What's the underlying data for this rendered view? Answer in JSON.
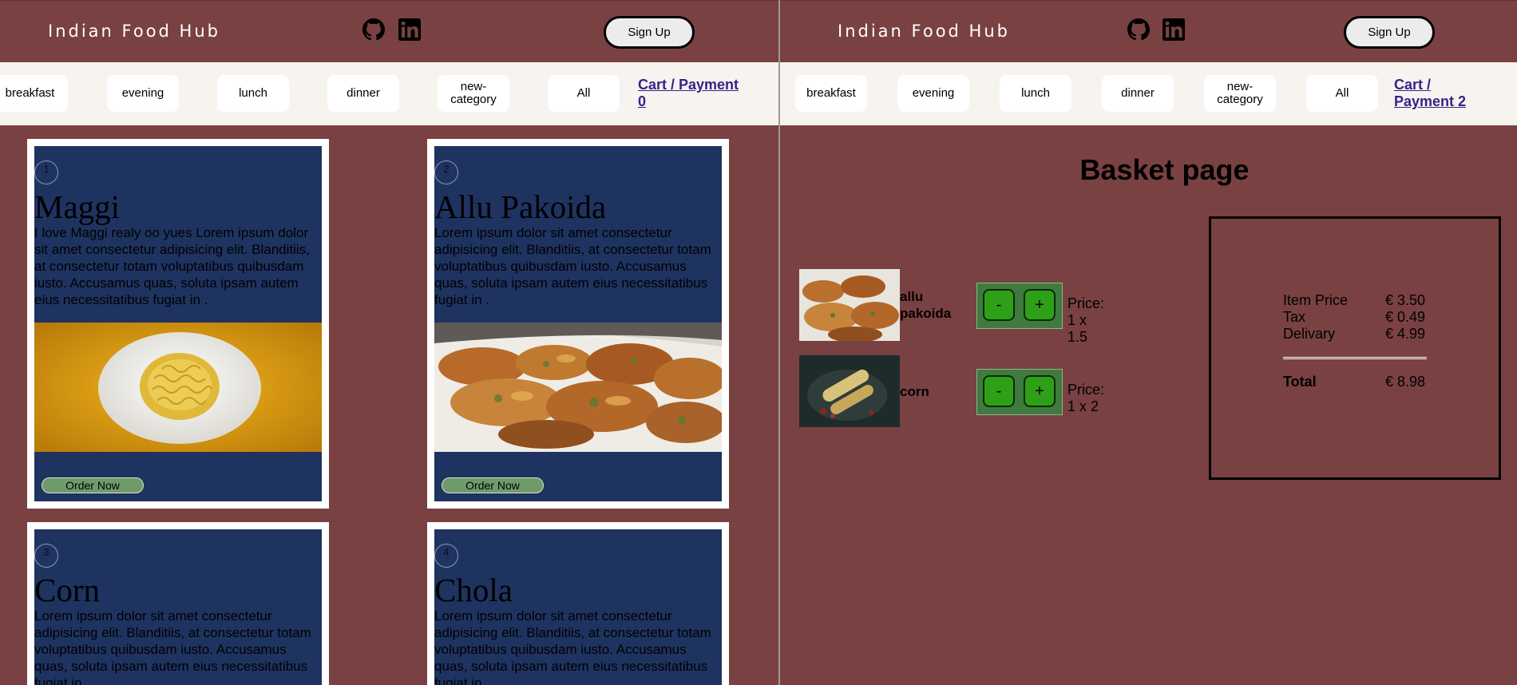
{
  "header": {
    "brand": "Indian Food Hub",
    "signup_label": "Sign Up",
    "icons": [
      "github-icon",
      "linkedin-icon"
    ]
  },
  "categories": [
    "breakfast",
    "evening",
    "lunch",
    "dinner",
    "new-category",
    "All"
  ],
  "left_cart_link": "Cart / Payment 0",
  "right_cart_link": "Cart / Payment 2",
  "cards": [
    {
      "num": "1",
      "title": "Maggi",
      "text": "I love Maggi realy oo yues Lorem ipsum dolor sit amet consectetur adipisicing elit. Blanditiis, at consectetur totam voluptatibus quibusdam iusto. Accusamus quas, soluta ipsam autem eius necessitatibus fugiat in .",
      "button": "Order Now"
    },
    {
      "num": "2",
      "title": "Allu Pakoida",
      "text": "Lorem ipsum dolor sit amet consectetur adipisicing elit. Blanditiis, at consectetur totam voluptatibus quibusdam iusto. Accusamus quas, soluta ipsam autem eius necessitatibus fugiat in .",
      "button": "Order Now"
    },
    {
      "num": "3",
      "title": "Corn",
      "text": "Lorem ipsum dolor sit amet consectetur adipisicing elit. Blanditiis, at consectetur totam voluptatibus quibusdam iusto. Accusamus quas, soluta ipsam autem eius necessitatibus fugiat in ."
    },
    {
      "num": "4",
      "title": "Chola",
      "text": "Lorem ipsum dolor sit amet consectetur adipisicing elit. Blanditiis, at consectetur totam voluptatibus quibusdam iusto. Accusamus quas, soluta ipsam autem eius necessitatibus fugiat in ."
    }
  ],
  "basket": {
    "title": "Basket page",
    "items": [
      {
        "name": "allu pakoida",
        "minus": "-",
        "plus": "+",
        "price": "Price: 1 x 1.5"
      },
      {
        "name": "corn",
        "minus": "-",
        "plus": "+",
        "price": "Price: 1 x 2"
      }
    ],
    "summary": {
      "item_price_label": "Item Price",
      "item_price": "€ 3.50",
      "tax_label": "Tax",
      "tax": "€ 0.49",
      "delivery_label": "Delivary",
      "delivery": "€ 4.99",
      "total_label": "Total",
      "total": "€ 8.98"
    }
  },
  "colors": {
    "page_bg": "#7a4142",
    "card_bg": "#1e3360",
    "category_bar": "#f7f4ef",
    "qty_box": "#3f7a3e",
    "qty_button": "#2ea017",
    "link": "#3b1e8a"
  }
}
